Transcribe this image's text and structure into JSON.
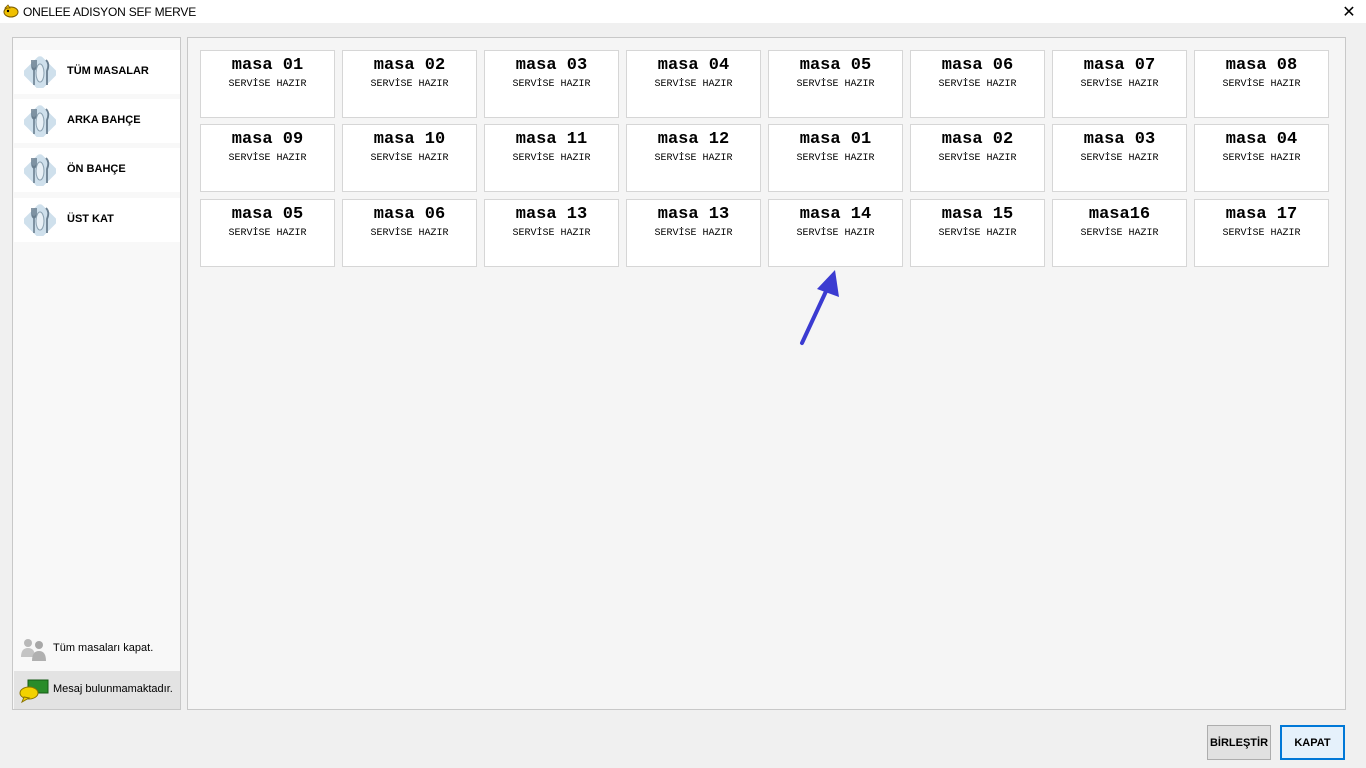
{
  "window": {
    "title": "ONELEE ADISYON SEF MERVE",
    "close_glyph": "✕"
  },
  "sidebar": {
    "items": [
      {
        "label": "TÜM MASALAR",
        "icon": "cutlery-icon"
      },
      {
        "label": "ARKA BAHÇE",
        "icon": "cutlery-icon"
      },
      {
        "label": "ÖN BAHÇE",
        "icon": "cutlery-icon"
      },
      {
        "label": "ÜST KAT",
        "icon": "cutlery-icon"
      }
    ],
    "close_all_label": "Tüm masaları kapat.",
    "message_label": "Mesaj bulunmamaktadır."
  },
  "tables": [
    {
      "name": "masa 01",
      "status": "SERVİSE HAZIR"
    },
    {
      "name": "masa 02",
      "status": "SERVİSE HAZIR"
    },
    {
      "name": "masa 03",
      "status": "SERVİSE HAZIR"
    },
    {
      "name": "masa 04",
      "status": "SERVİSE HAZIR"
    },
    {
      "name": "masa 05",
      "status": "SERVİSE HAZIR"
    },
    {
      "name": "masa 06",
      "status": "SERVİSE HAZIR"
    },
    {
      "name": "masa 07",
      "status": "SERVİSE HAZIR"
    },
    {
      "name": "masa 08",
      "status": "SERVİSE HAZIR"
    },
    {
      "name": "masa 09",
      "status": "SERVİSE HAZIR"
    },
    {
      "name": "masa 10",
      "status": "SERVİSE HAZIR"
    },
    {
      "name": "masa 11",
      "status": "SERVİSE HAZIR"
    },
    {
      "name": "masa 12",
      "status": "SERVİSE HAZIR"
    },
    {
      "name": "masa 01",
      "status": "SERVİSE HAZIR"
    },
    {
      "name": "masa 02",
      "status": "SERVİSE HAZIR"
    },
    {
      "name": "masa 03",
      "status": "SERVİSE HAZIR"
    },
    {
      "name": "masa 04",
      "status": "SERVİSE HAZIR"
    },
    {
      "name": "masa 05",
      "status": "SERVİSE HAZIR"
    },
    {
      "name": "masa 06",
      "status": "SERVİSE HAZIR"
    },
    {
      "name": "masa 13",
      "status": "SERVİSE HAZIR"
    },
    {
      "name": "masa 13",
      "status": "SERVİSE HAZIR"
    },
    {
      "name": "masa 14",
      "status": "SERVİSE HAZIR"
    },
    {
      "name": "masa 15",
      "status": "SERVİSE HAZIR"
    },
    {
      "name": "masa16",
      "status": "SERVİSE HAZIR"
    },
    {
      "name": "masa 17",
      "status": "SERVİSE HAZIR"
    }
  ],
  "buttons": {
    "merge_label": "BİRLEŞTİR",
    "close_label": "KAPAT"
  },
  "colors": {
    "annotation_arrow": "#3b3bd1",
    "primary_border": "#0078d7"
  }
}
